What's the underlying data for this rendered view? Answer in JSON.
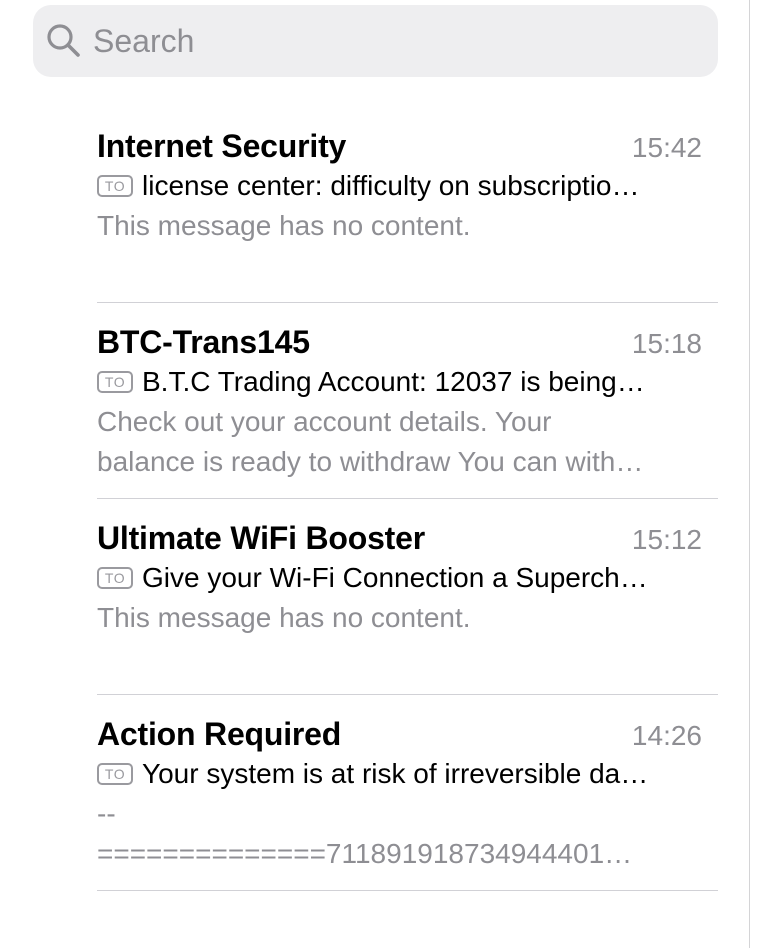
{
  "search": {
    "placeholder": "Search",
    "value": ""
  },
  "icons": {
    "search": "search-icon",
    "to": "to-badge-icon"
  },
  "colors": {
    "secondary_text": "#8e8e93",
    "search_background": "#eeeef0"
  },
  "messages": [
    {
      "sender": "Internet Security",
      "time": "15:42",
      "to_badge": "TO",
      "subject": "license center: difficulty on subscriptio…",
      "preview_lines": [
        "This message has no content."
      ]
    },
    {
      "sender": "BTC-Trans145",
      "time": "15:18",
      "to_badge": "TO",
      "subject": "B.T.C Trading Account: 12037 is being…",
      "preview_lines": [
        "Check out your account details. Your",
        "balance is ready to withdraw You can with…"
      ]
    },
    {
      "sender": "Ultimate WiFi Booster",
      "time": "15:12",
      "to_badge": "TO",
      "subject": "Give your Wi-Fi Connection a Superch…",
      "preview_lines": [
        "This message has no content."
      ]
    },
    {
      "sender": "Action Required",
      "time": "14:26",
      "to_badge": "TO",
      "subject": "Your system is at risk of irreversible da…",
      "preview_lines": [
        "--",
        "==============711891918734944401…"
      ]
    }
  ]
}
